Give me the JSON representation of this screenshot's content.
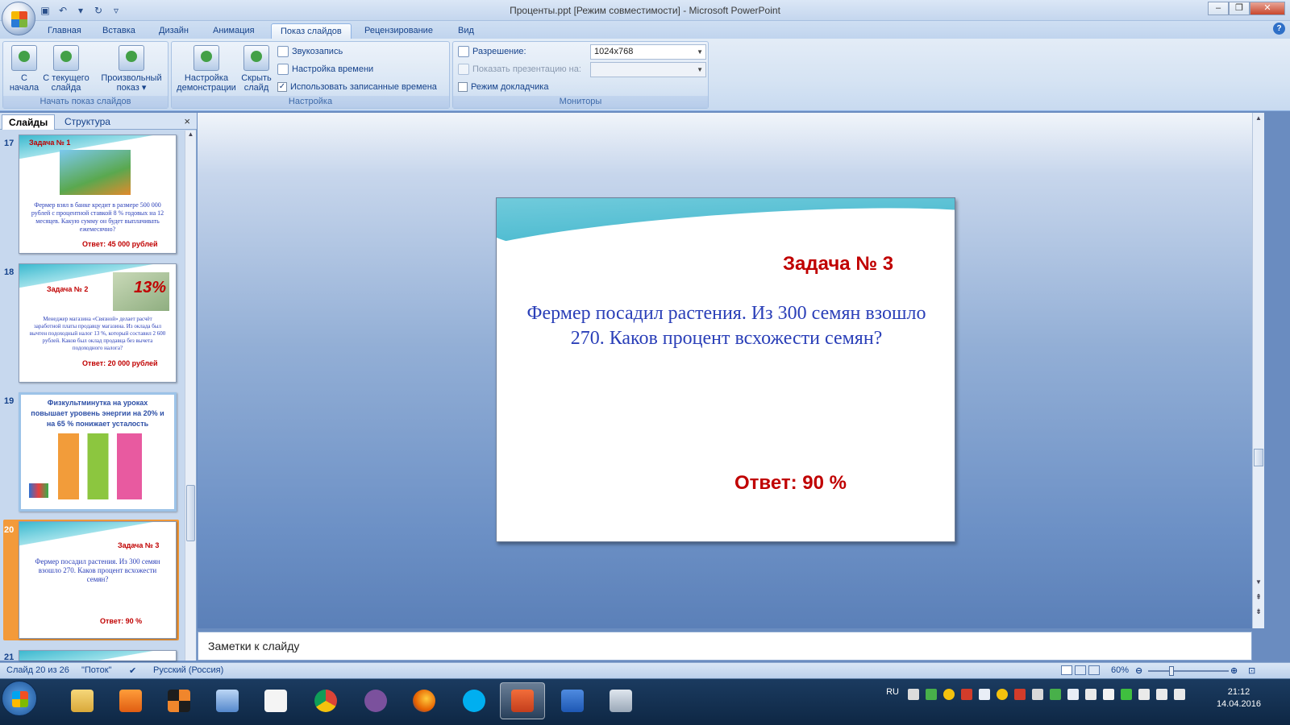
{
  "window": {
    "title": "Проценты.ppt [Режим совместимости] - Microsoft PowerPoint"
  },
  "tabs": [
    "Главная",
    "Вставка",
    "Дизайн",
    "Анимация",
    "Показ слайдов",
    "Рецензирование",
    "Вид"
  ],
  "active_tab": "Показ слайдов",
  "ribbon": {
    "start_group": {
      "label": "Начать показ слайдов",
      "from_start": "С начала",
      "from_current": "С текущего слайда",
      "custom_show": "Произвольный показ"
    },
    "setup_group": {
      "label": "Настройка",
      "setup_show": "Настройка демонстрации",
      "hide_slide": "Скрыть слайд",
      "record_narration": "Звукозапись",
      "rehearse_timings": "Настройка времени",
      "use_timings": "Использовать записанные времена"
    },
    "monitors_group": {
      "label": "Мониторы",
      "resolution_label": "Разрешение:",
      "resolution_value": "1024x768",
      "show_on_label": "Показать презентацию на:",
      "presenter_view": "Режим докладчика"
    }
  },
  "left_pane": {
    "tab_slides": "Слайды",
    "tab_outline": "Структура",
    "close": "×",
    "thumbnails": [
      {
        "number": "17",
        "title": "Задача № 1",
        "text": "Фермер взял в банке кредит в размере 500 000 рублей с процентной ставкой 8 % годовых на 12 месяцев. Какую сумму он будет выплачивать ежемесячно?",
        "answer": "Ответ: 45 000 рублей"
      },
      {
        "number": "18",
        "title": "Задача № 2",
        "text": "Менеджер магазина «Связной» делает расчёт заработной платы продавцу магазина. Из оклада был вычтен подоходный налог 13 %, который составил 2 600 рублей. Каков был оклад продавца без вычета подоходного налога?",
        "answer": "Ответ: 20 000 рублей",
        "badge": "13%"
      },
      {
        "number": "19",
        "title": "Физкультминутка на уроках повышает уровень энергии на 20% и на 65 % понижает усталость"
      },
      {
        "number": "20",
        "title": "Задача № 3",
        "text": "Фермер посадил растения. Из 300 семян взошло 270. Каков процент всхожести семян?",
        "answer": "Ответ: 90 %"
      },
      {
        "number": "21"
      }
    ]
  },
  "slide": {
    "title": "Задача № 3",
    "body": "Фермер посадил растения. Из 300 семян взошло 270. Каков процент всхожести семян?",
    "answer": "Ответ: 90 %"
  },
  "notes": {
    "placeholder": "Заметки к слайду"
  },
  "status": {
    "slide_counter": "Слайд 20 из 26",
    "theme": "\"Поток\"",
    "language": "Русский (Россия)",
    "zoom": "60%"
  },
  "taskbar": {
    "lang": "RU",
    "time": "21:12",
    "date": "14.04.2016",
    "apps": [
      "explorer",
      "media-player",
      "office-tools",
      "speakers",
      "document",
      "chrome",
      "viber",
      "firefox",
      "skype",
      "powerpoint",
      "word",
      "calculator"
    ]
  }
}
